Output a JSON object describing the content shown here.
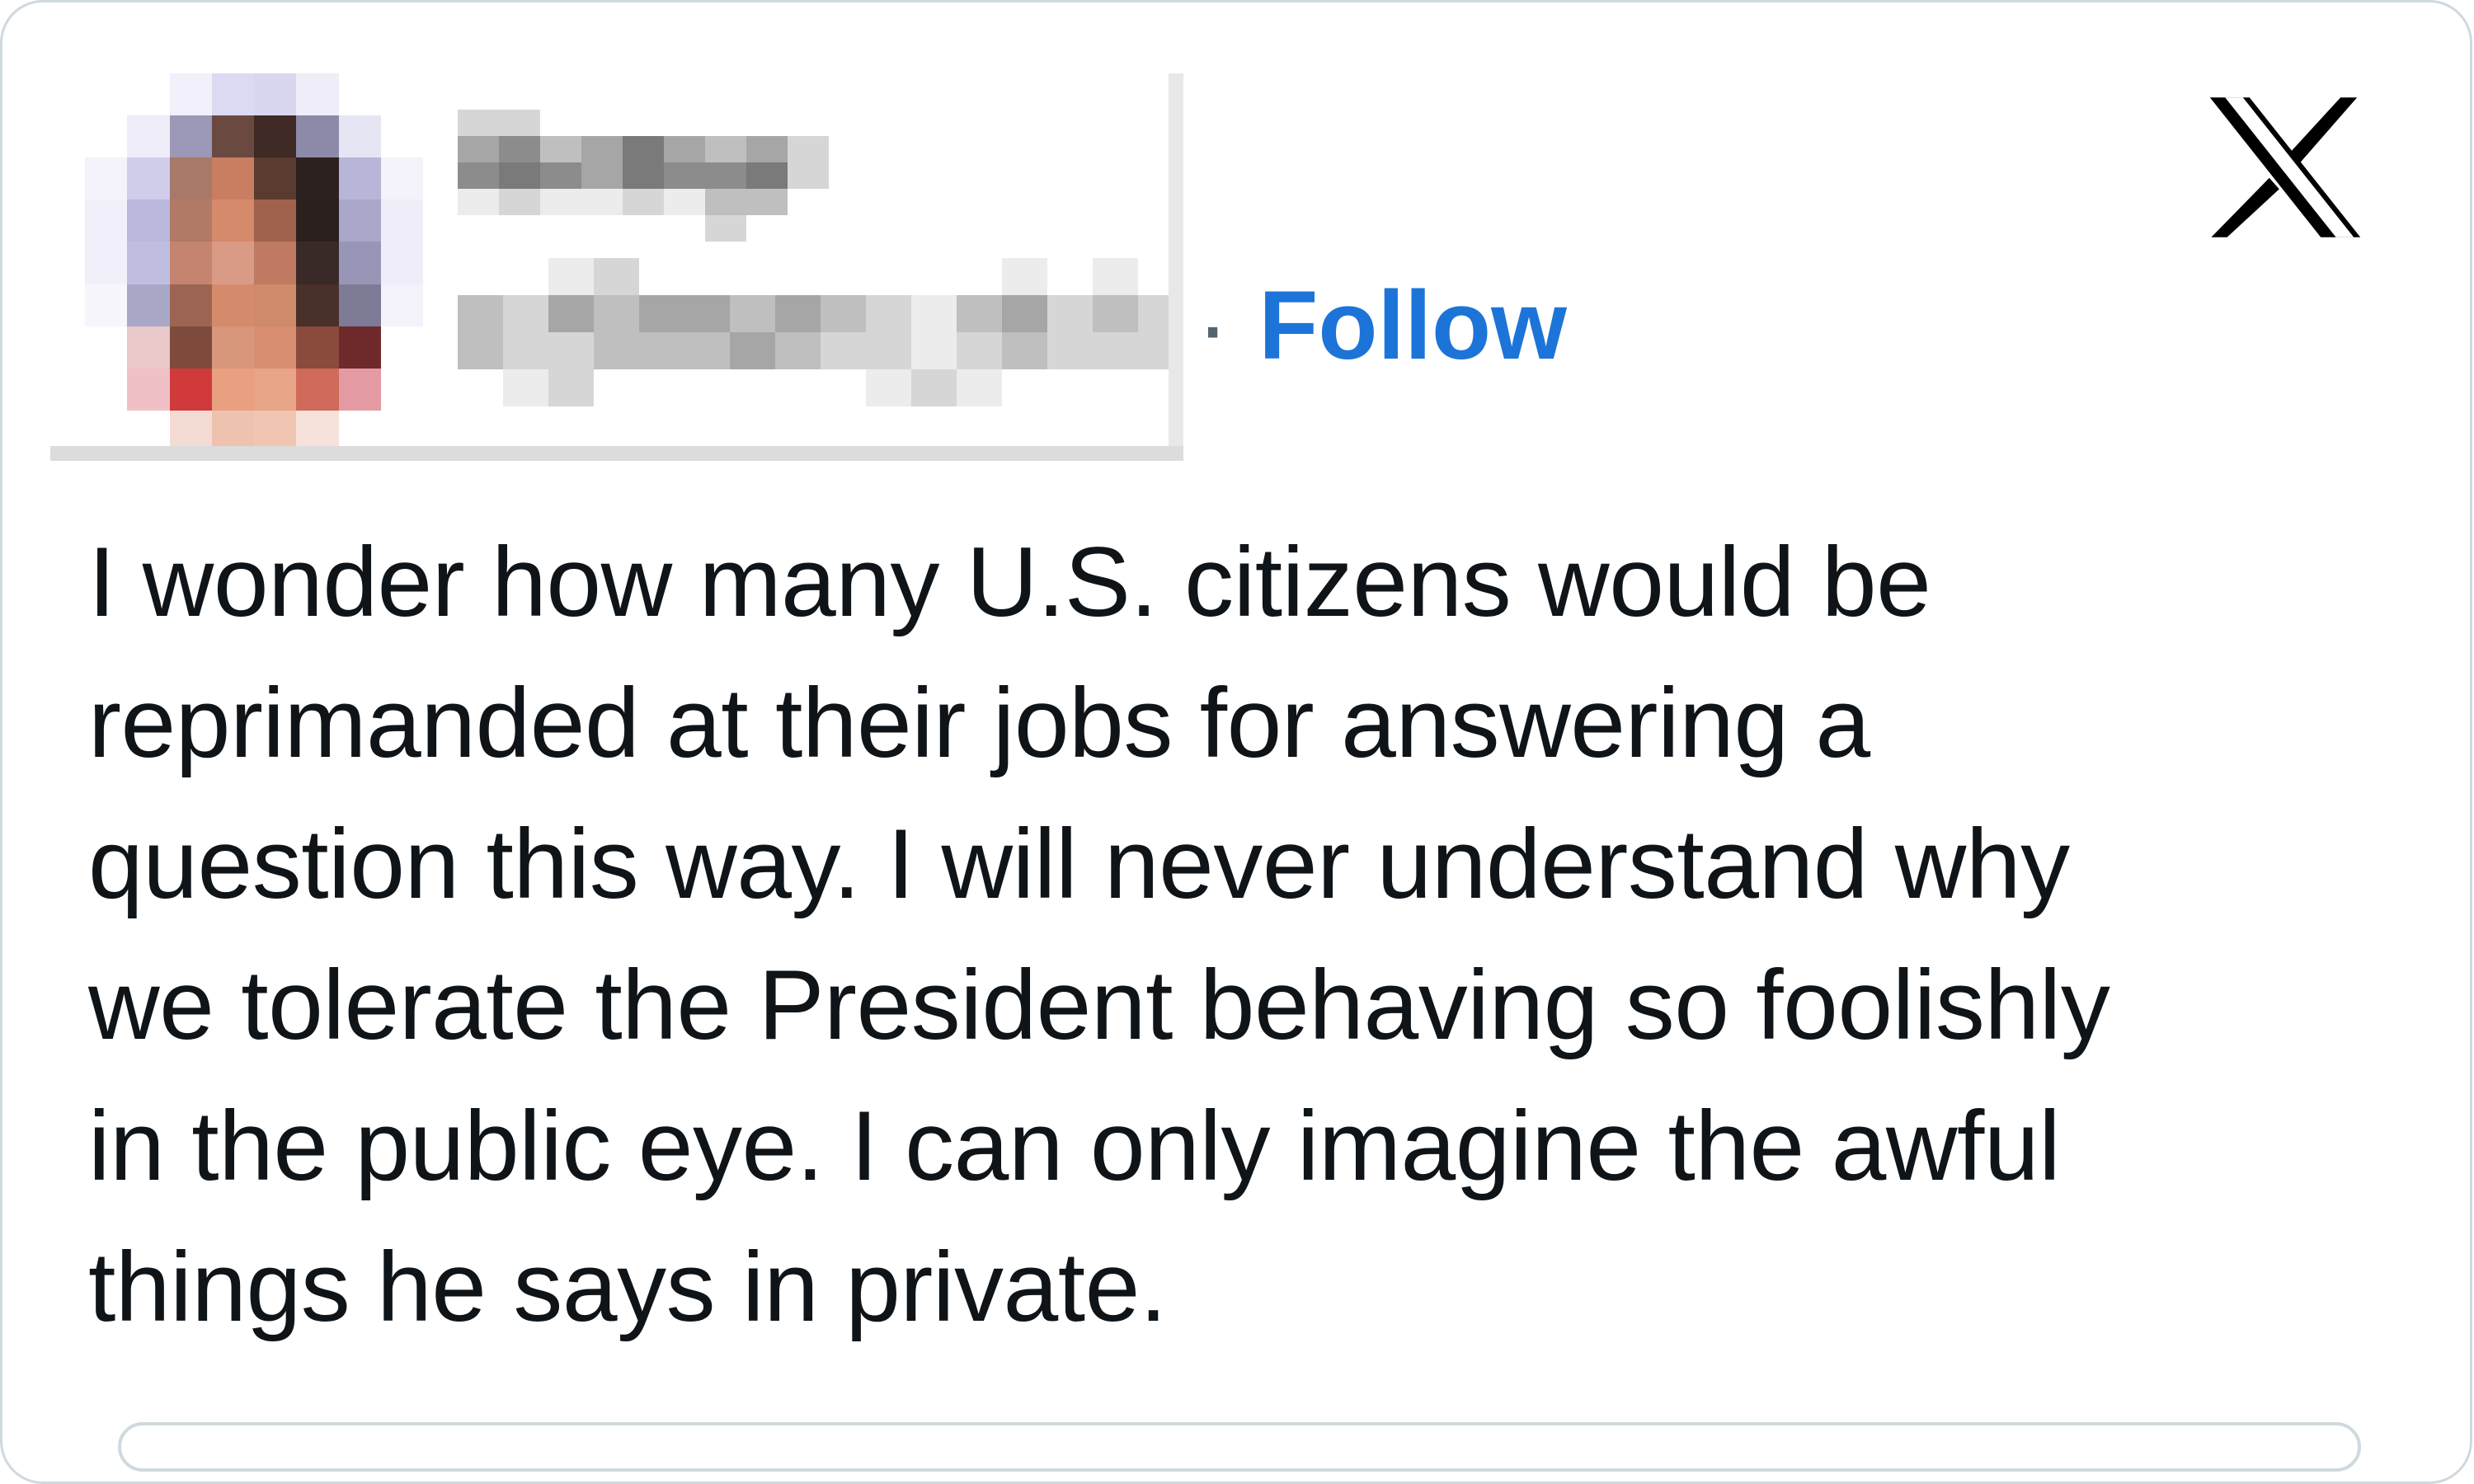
{
  "follow_label": "Follow",
  "separator": "·",
  "tweet_text": "I wonder how many U.S. citizens would be\nreprimanded at their jobs for answering a\nquestion this way. I will never understand why\nwe tolerate the President behaving so foolishly\nin the public eye. I can only imagine the awful\nthings he says in private.",
  "colors": {
    "follow": "#1d74d8",
    "text": "#0f1419",
    "border": "#cfd9de"
  },
  "icons": {
    "brand": "x-logo-icon"
  }
}
